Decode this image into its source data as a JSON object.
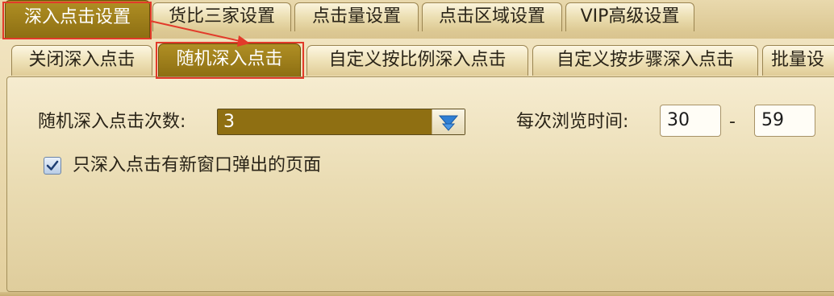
{
  "top_tabs": [
    {
      "label": "深入点击设置",
      "active": true
    },
    {
      "label": "货比三家设置",
      "active": false
    },
    {
      "label": "点击量设置",
      "active": false
    },
    {
      "label": "点击区域设置",
      "active": false
    },
    {
      "label": "VIP高级设置",
      "active": false
    }
  ],
  "sub_tabs": [
    {
      "label": "关闭深入点击",
      "active": false
    },
    {
      "label": "随机深入点击",
      "active": true
    },
    {
      "label": "自定义按比例深入点击",
      "active": false
    },
    {
      "label": "自定义按步骤深入点击",
      "active": false
    },
    {
      "label": "批量设",
      "active": false
    }
  ],
  "random_click": {
    "count_label": "随机深入点击次数:",
    "count_value": "3",
    "browse_label": "每次浏览时间:",
    "browse_min": "30",
    "browse_sep": "-",
    "browse_max": "59",
    "popup_only_label": "只深入点击有新窗口弹出的页面",
    "popup_only_checked": true
  },
  "annotation": {
    "color": "#e23a2a"
  },
  "accent": "#8f6f12"
}
